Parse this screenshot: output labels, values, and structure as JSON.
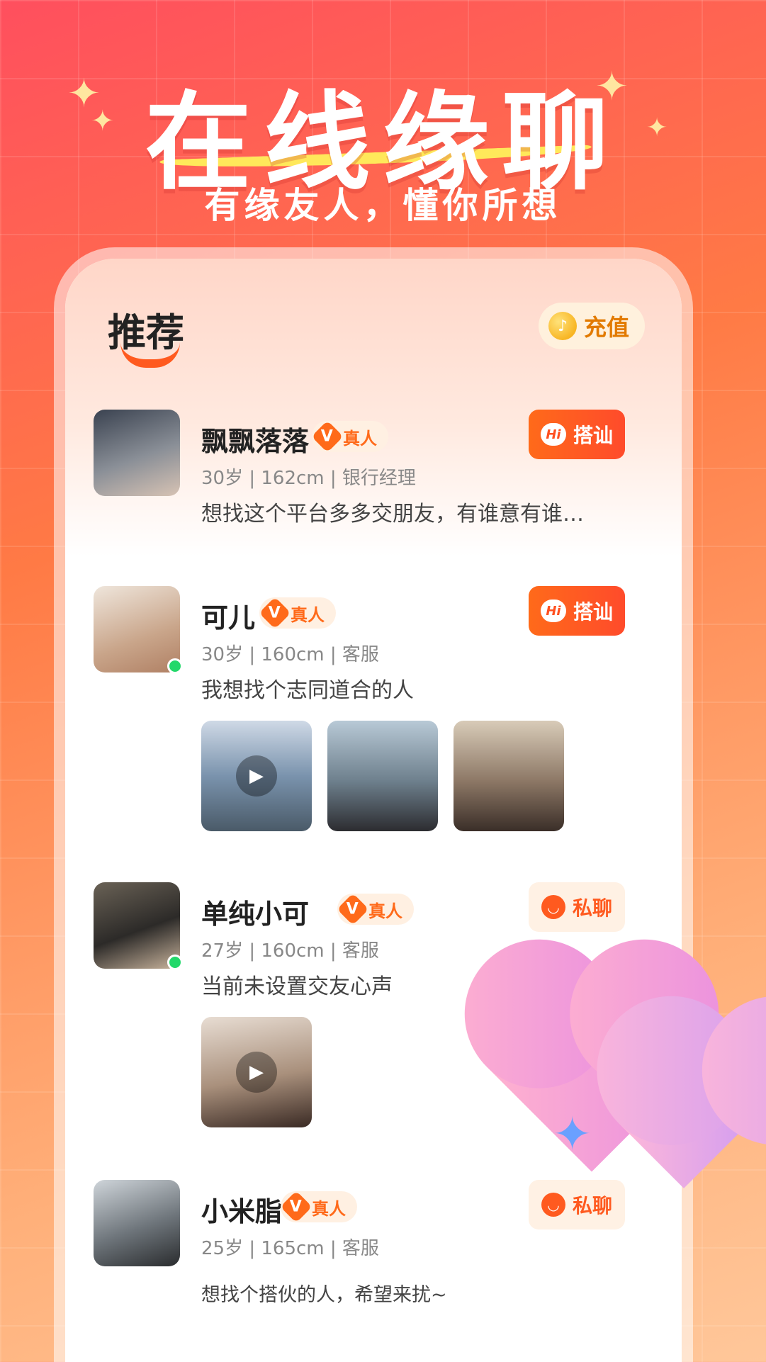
{
  "hero": {
    "title": "在线缘聊",
    "subtitle": "有缘友人，懂你所想"
  },
  "header": {
    "section_title": "推荐",
    "recharge_label": "充值"
  },
  "badge_text": "真人",
  "buttons": {
    "hi_label": "搭讪",
    "chat_label": "私聊",
    "hi_icon_text": "Hi"
  },
  "users": [
    {
      "name": "飘飘落落",
      "meta": "30岁 | 162cm | 银行经理",
      "bio": "想找这个平台多多交朋友，有谁意有谁…",
      "action": "hi",
      "online": false,
      "thumbs": []
    },
    {
      "name": "可儿",
      "meta": "30岁 | 160cm | 客服",
      "bio": "我想找个志同道合的人",
      "action": "hi",
      "online": true,
      "thumbs": [
        {
          "video": true
        },
        {
          "video": false
        },
        {
          "video": false
        }
      ]
    },
    {
      "name": "单纯小可",
      "meta": "27岁 | 160cm | 客服",
      "bio": "当前未设置交友心声",
      "action": "chat",
      "online": true,
      "thumbs": [
        {
          "video": true
        }
      ]
    },
    {
      "name": "小米脂",
      "meta": "25岁 | 165cm | 客服",
      "bio": "想找个搭伙的人，希望来扰~",
      "action": "chat",
      "online": false,
      "thumbs": []
    }
  ],
  "colors": {
    "accent": "#ff5a1f",
    "badge": "#ff6a1a",
    "online": "#22d86a"
  }
}
